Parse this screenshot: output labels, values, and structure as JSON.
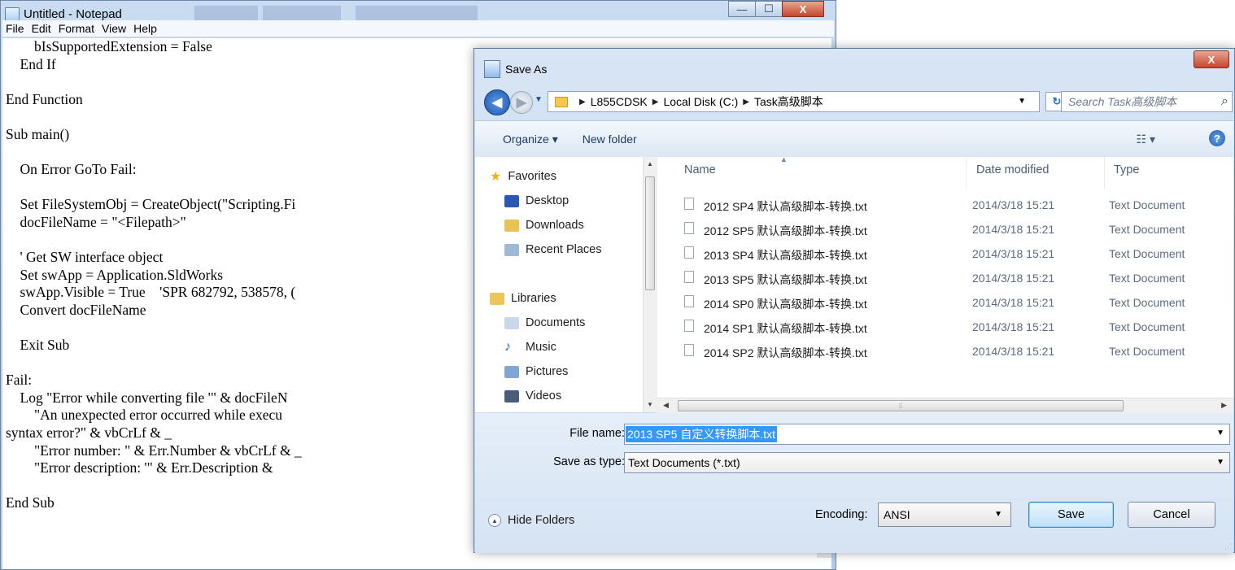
{
  "notepad": {
    "title": "Untitled - Notepad",
    "menu": [
      "File",
      "Edit",
      "Format",
      "View",
      "Help"
    ],
    "code": "        bIsSupportedExtension = False\n    End If\n\nEnd Function\n\nSub main()\n\n    On Error GoTo Fail:\n\n    Set FileSystemObj = CreateObject(\"Scripting.Fi\n    docFileName = \"<Filepath>\"\n\n    ' Get SW interface object\n    Set swApp = Application.SldWorks\n    swApp.Visible = True    'SPR 682792, 538578, (\n    Convert docFileName\n\n    Exit Sub\n\nFail:\n    Log \"Error while converting file '\" & docFileN\n        \"An unexpected error occurred while execu\nsyntax error?\" & vbCrLf & _\n        \"Error number: \" & Err.Number & vbCrLf & _\n        \"Error description: '\" & Err.Description &\n\nEnd Sub"
  },
  "dialog": {
    "title": "Save As",
    "close_label": "X",
    "breadcrumb": [
      "L855CDSK",
      "Local Disk (C:)",
      "Task高级脚本"
    ],
    "search_placeholder": "Search Task高级脚本",
    "toolbar": {
      "organize": "Organize ▾",
      "new_folder": "New folder",
      "help": "?"
    },
    "nav": {
      "favorites_header": "Favorites",
      "favorites": [
        "Desktop",
        "Downloads",
        "Recent Places"
      ],
      "libraries_header": "Libraries",
      "libraries": [
        "Documents",
        "Music",
        "Pictures",
        "Videos"
      ]
    },
    "columns": {
      "name": "Name",
      "date": "Date modified",
      "type": "Type"
    },
    "files": [
      {
        "name": "2012 SP4 默认高级脚本-转换.txt",
        "date": "2014/3/18 15:21",
        "type": "Text Document"
      },
      {
        "name": "2012 SP5 默认高级脚本-转换.txt",
        "date": "2014/3/18 15:21",
        "type": "Text Document"
      },
      {
        "name": "2013 SP4 默认高级脚本-转换.txt",
        "date": "2014/3/18 15:21",
        "type": "Text Document"
      },
      {
        "name": "2013 SP5 默认高级脚本-转换.txt",
        "date": "2014/3/18 15:21",
        "type": "Text Document"
      },
      {
        "name": "2014 SP0 默认高级脚本-转换.txt",
        "date": "2014/3/18 15:21",
        "type": "Text Document"
      },
      {
        "name": "2014 SP1 默认高级脚本-转换.txt",
        "date": "2014/3/18 15:21",
        "type": "Text Document"
      },
      {
        "name": "2014 SP2 默认高级脚本-转换.txt",
        "date": "2014/3/18 15:21",
        "type": "Text Document"
      }
    ],
    "file_name_label": "File name:",
    "file_name_value": "2013 SP5 自定义转换脚本.txt",
    "save_type_label": "Save as type:",
    "save_type_value": "Text Documents (*.txt)",
    "hide_folders": "Hide Folders",
    "encoding_label": "Encoding:",
    "encoding_value": "ANSI",
    "save_button": "Save",
    "cancel_button": "Cancel"
  },
  "colors": {
    "selection": "#3399ff",
    "close_red": "#c5462c",
    "frame_blue": "#c3d6ee"
  }
}
